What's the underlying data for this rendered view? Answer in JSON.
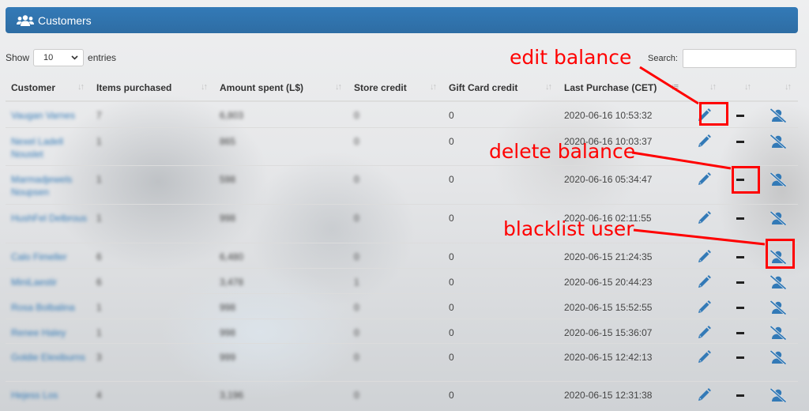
{
  "panel": {
    "title": "Customers",
    "icon": "users-icon",
    "accent_color": "#337ab7"
  },
  "length_menu": {
    "prefix": "Show",
    "selected": "10",
    "suffix": "entries"
  },
  "search": {
    "label": "Search:",
    "value": "",
    "placeholder": ""
  },
  "table": {
    "columns": [
      {
        "label": "Customer",
        "sort": "both"
      },
      {
        "label": "Items purchased",
        "sort": "both"
      },
      {
        "label": "Amount spent (L$)",
        "sort": "both"
      },
      {
        "label": "Store credit",
        "sort": "both"
      },
      {
        "label": "Gift Card credit",
        "sort": "both"
      },
      {
        "label": "Last Purchase (CET)",
        "sort": "desc"
      },
      {
        "label": "",
        "sort": "both"
      },
      {
        "label": "",
        "sort": "both"
      },
      {
        "label": "",
        "sort": "both"
      }
    ],
    "rows": [
      {
        "customer": "Vaugan Varnes",
        "items": "7",
        "amount": "6,803",
        "store_credit": "0",
        "gift_card_credit": "0",
        "last_purchase": "2020-06-16 10:53:32"
      },
      {
        "customer": "Nexel Ladell Nouslet",
        "items": "1",
        "amount": "865",
        "store_credit": "0",
        "gift_card_credit": "0",
        "last_purchase": "2020-06-16 10:03:37"
      },
      {
        "customer": "Marmadjewels Noupsen",
        "items": "1",
        "amount": "598",
        "store_credit": "0",
        "gift_card_credit": "0",
        "last_purchase": "2020-06-16 05:34:47"
      },
      {
        "customer": "HushFel Delbrous",
        "items": "1",
        "amount": "998",
        "store_credit": "0",
        "gift_card_credit": "0",
        "last_purchase": "2020-06-16 02:11:55"
      },
      {
        "customer": "Calo Fimeller",
        "items": "6",
        "amount": "6,480",
        "store_credit": "0",
        "gift_card_credit": "0",
        "last_purchase": "2020-06-15 21:24:35"
      },
      {
        "customer": "MiniLaestir",
        "items": "6",
        "amount": "3,478",
        "store_credit": "1",
        "gift_card_credit": "0",
        "last_purchase": "2020-06-15 20:44:23"
      },
      {
        "customer": "Rosa Bolbalina",
        "items": "1",
        "amount": "998",
        "store_credit": "0",
        "gift_card_credit": "0",
        "last_purchase": "2020-06-15 15:52:55"
      },
      {
        "customer": "Renee Haley",
        "items": "1",
        "amount": "998",
        "store_credit": "0",
        "gift_card_credit": "0",
        "last_purchase": "2020-06-15 15:36:07"
      },
      {
        "customer": "Goldie Elexiburns",
        "items": "3",
        "amount": "999",
        "store_credit": "0",
        "gift_card_credit": "0",
        "last_purchase": "2020-06-15 12:42:13"
      },
      {
        "customer": "Hejess Los",
        "items": "4",
        "amount": "3,196",
        "store_credit": "0",
        "gift_card_credit": "0",
        "last_purchase": "2020-06-15 12:31:38"
      }
    ],
    "row_actions": [
      "edit-balance",
      "delete-balance",
      "blacklist-user"
    ],
    "action_color": "#337ab7"
  },
  "annotations": [
    {
      "label": "edit balance",
      "target": "edit-balance-button"
    },
    {
      "label": "delete balance",
      "target": "delete-balance-button"
    },
    {
      "label": "blacklist user",
      "target": "blacklist-user-button"
    }
  ],
  "annotation_color": "#ff0000"
}
